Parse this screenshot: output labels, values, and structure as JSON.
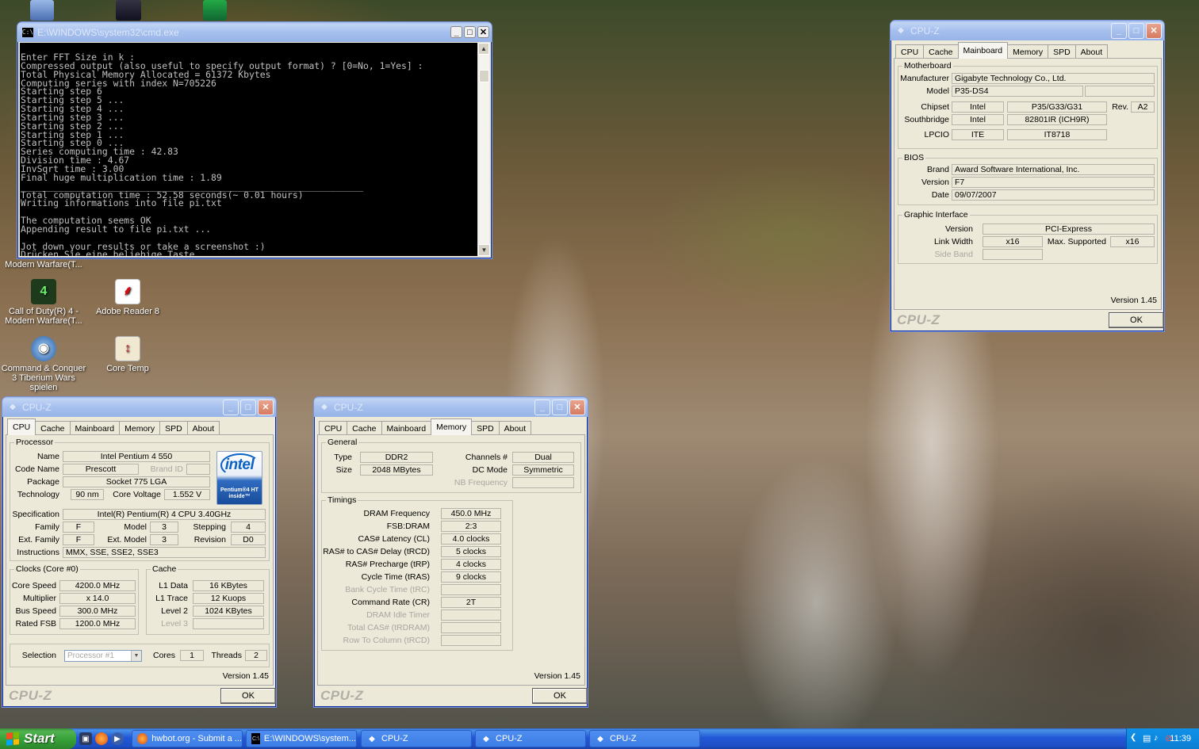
{
  "desktop": {
    "icons": [
      {
        "label": "Call of Duty(R) 4 - Modern Warfare(T...",
        "glyph": "cod4-icon"
      },
      {
        "label": "Adobe Reader 8",
        "glyph": "pdf-icon"
      },
      {
        "label": "Command & Conquer 3 Tiberium Wars spielen",
        "glyph": "cnc3-icon"
      },
      {
        "label": "Core Temp",
        "glyph": "thermometer-icon"
      },
      {
        "label": "Modern Warfare(T...",
        "glyph": "partial"
      }
    ]
  },
  "cmd": {
    "title": "E:\\WINDOWS\\system32\\cmd.exe",
    "output": "Enter FFT Size in k :\nCompressed output (also useful to specify output format) ? [0=No, 1=Yes] :\nTotal Physical Memory Allocated = 61372 Kbytes\nComputing series with index N=705226\nStarting step 6\nStarting step 5 ...\nStarting step 4 ...\nStarting step 3 ...\nStarting step 2 ...\nStarting step 1 ...\nStarting step 0 ...\nSeries computing time : 42.83\nDivision time : 4.67\nInvSqrt time : 3.00\nFinal huge multiplication time : 1.89\n_______________________________________________________________\nTotal computation time : 52.58 seconds(~ 0.01 hours)\nWriting informations into file pi.txt\n\nThe computation seems OK\nAppending result to file pi.txt ...\n\nJot down your results or take a screenshot :)\nDrücken Sie eine beliebige Taste . . ."
  },
  "cpuz_common": {
    "title": "CPU-Z",
    "tabs": [
      "CPU",
      "Cache",
      "Mainboard",
      "Memory",
      "SPD",
      "About"
    ],
    "version": "Version 1.45",
    "brand": "CPU-Z",
    "ok": "OK"
  },
  "mainboard": {
    "motherboard_title": "Motherboard",
    "manufacturer_label": "Manufacturer",
    "manufacturer": "Gigabyte Technology Co., Ltd.",
    "model_label": "Model",
    "model": "P35-DS4",
    "chipset_label": "Chipset",
    "chipset_vendor": "Intel",
    "chipset": "P35/G33/G31",
    "rev_label": "Rev.",
    "rev": "A2",
    "southbridge_label": "Southbridge",
    "southbridge_vendor": "Intel",
    "southbridge": "82801IR (ICH9R)",
    "lpcio_label": "LPCIO",
    "lpcio_vendor": "ITE",
    "lpcio": "IT8718",
    "bios_title": "BIOS",
    "brand_label": "Brand",
    "bios_brand": "Award Software International, Inc.",
    "version_label": "Version",
    "bios_version": "F7",
    "date_label": "Date",
    "bios_date": "09/07/2007",
    "gi_title": "Graphic Interface",
    "gi_version_label": "Version",
    "gi_version": "PCI-Express",
    "link_width_label": "Link Width",
    "link_width": "x16",
    "max_supported_label": "Max. Supported",
    "max_supported": "x16",
    "side_band_label": "Side Band"
  },
  "cpu": {
    "processor_title": "Processor",
    "name_label": "Name",
    "name": "Intel Pentium 4 550",
    "codename_label": "Code Name",
    "codename": "Prescott",
    "brand_id_label": "Brand ID",
    "package_label": "Package",
    "package": "Socket 775 LGA",
    "technology_label": "Technology",
    "technology": "90 nm",
    "core_voltage_label": "Core Voltage",
    "core_voltage": "1.552 V",
    "spec_label": "Specification",
    "spec": "Intel(R) Pentium(R) 4 CPU 3.40GHz",
    "family_label": "Family",
    "family": "F",
    "model_label": "Model",
    "model": "3",
    "stepping_label": "Stepping",
    "stepping": "4",
    "ext_family_label": "Ext. Family",
    "ext_family": "F",
    "ext_model_label": "Ext. Model",
    "ext_model": "3",
    "revision_label": "Revision",
    "revision": "D0",
    "instructions_label": "Instructions",
    "instructions": "MMX, SSE, SSE2, SSE3",
    "logo_text": "intel",
    "logo_sub": "Pentium®4 HT inside™",
    "clocks_title": "Clocks (Core #0)",
    "core_speed_label": "Core Speed",
    "core_speed": "4200.0 MHz",
    "multiplier_label": "Multiplier",
    "multiplier": "x 14.0",
    "bus_speed_label": "Bus Speed",
    "bus_speed": "300.0 MHz",
    "rated_fsb_label": "Rated FSB",
    "rated_fsb": "1200.0 MHz",
    "cache_title": "Cache",
    "l1d_label": "L1 Data",
    "l1d": "16 KBytes",
    "l1t_label": "L1 Trace",
    "l1t": "12 Kuops",
    "l2_label": "Level 2",
    "l2": "1024 KBytes",
    "l3_label": "Level 3",
    "selection_label": "Selection",
    "selection": "Processor #1",
    "cores_label": "Cores",
    "cores": "1",
    "threads_label": "Threads",
    "threads": "2"
  },
  "memory": {
    "general_title": "General",
    "type_label": "Type",
    "type": "DDR2",
    "size_label": "Size",
    "size": "2048 MBytes",
    "channels_label": "Channels #",
    "channels": "Dual",
    "dc_mode_label": "DC Mode",
    "dc_mode": "Symmetric",
    "nb_freq_label": "NB Frequency",
    "timings_title": "Timings",
    "dram_freq_label": "DRAM Frequency",
    "dram_freq": "450.0 MHz",
    "fsb_dram_label": "FSB:DRAM",
    "fsb_dram": "2:3",
    "cas_label": "CAS# Latency (CL)",
    "cas": "4.0 clocks",
    "trcd_label": "RAS# to CAS# Delay (tRCD)",
    "trcd": "5 clocks",
    "trp_label": "RAS# Precharge (tRP)",
    "trp": "4 clocks",
    "tras_label": "Cycle Time (tRAS)",
    "tras": "9 clocks",
    "trc_label": "Bank Cycle Time (tRC)",
    "cr_label": "Command Rate (CR)",
    "cr": "2T",
    "idle_label": "DRAM Idle Timer",
    "trdram_label": "Total CAS# (tRDRAM)",
    "trcd2_label": "Row To Column (tRCD)"
  },
  "taskbar": {
    "start": "Start",
    "tasks": [
      "hwbot.org - Submit a ...",
      "E:\\WINDOWS\\system...",
      "CPU-Z",
      "CPU-Z",
      "CPU-Z"
    ],
    "clock": "11:39"
  },
  "colors": {
    "xp_blue": "#0054e3",
    "window_bg": "#ece9d8",
    "start_green": "#37a037"
  }
}
